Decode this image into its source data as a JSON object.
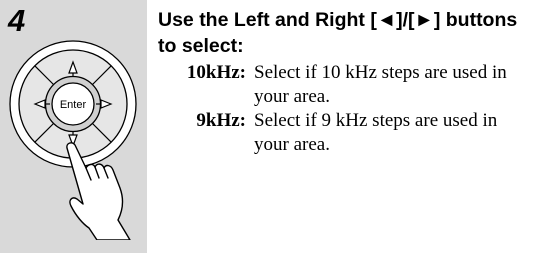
{
  "step": {
    "number": "4"
  },
  "remote": {
    "enter_label": "Enter",
    "icons": [
      "arrow-up-icon",
      "arrow-down-icon",
      "arrow-left-icon",
      "arrow-right-icon",
      "pointing-hand-icon"
    ]
  },
  "instruction": {
    "heading": "Use the Left and Right [◄]/[►] buttons to select:"
  },
  "options": [
    {
      "key": "10kHz:",
      "description": "Select if 10 kHz steps are used in your area."
    },
    {
      "key": "9kHz:",
      "description": "Select if 9 kHz steps are used in your area."
    }
  ]
}
